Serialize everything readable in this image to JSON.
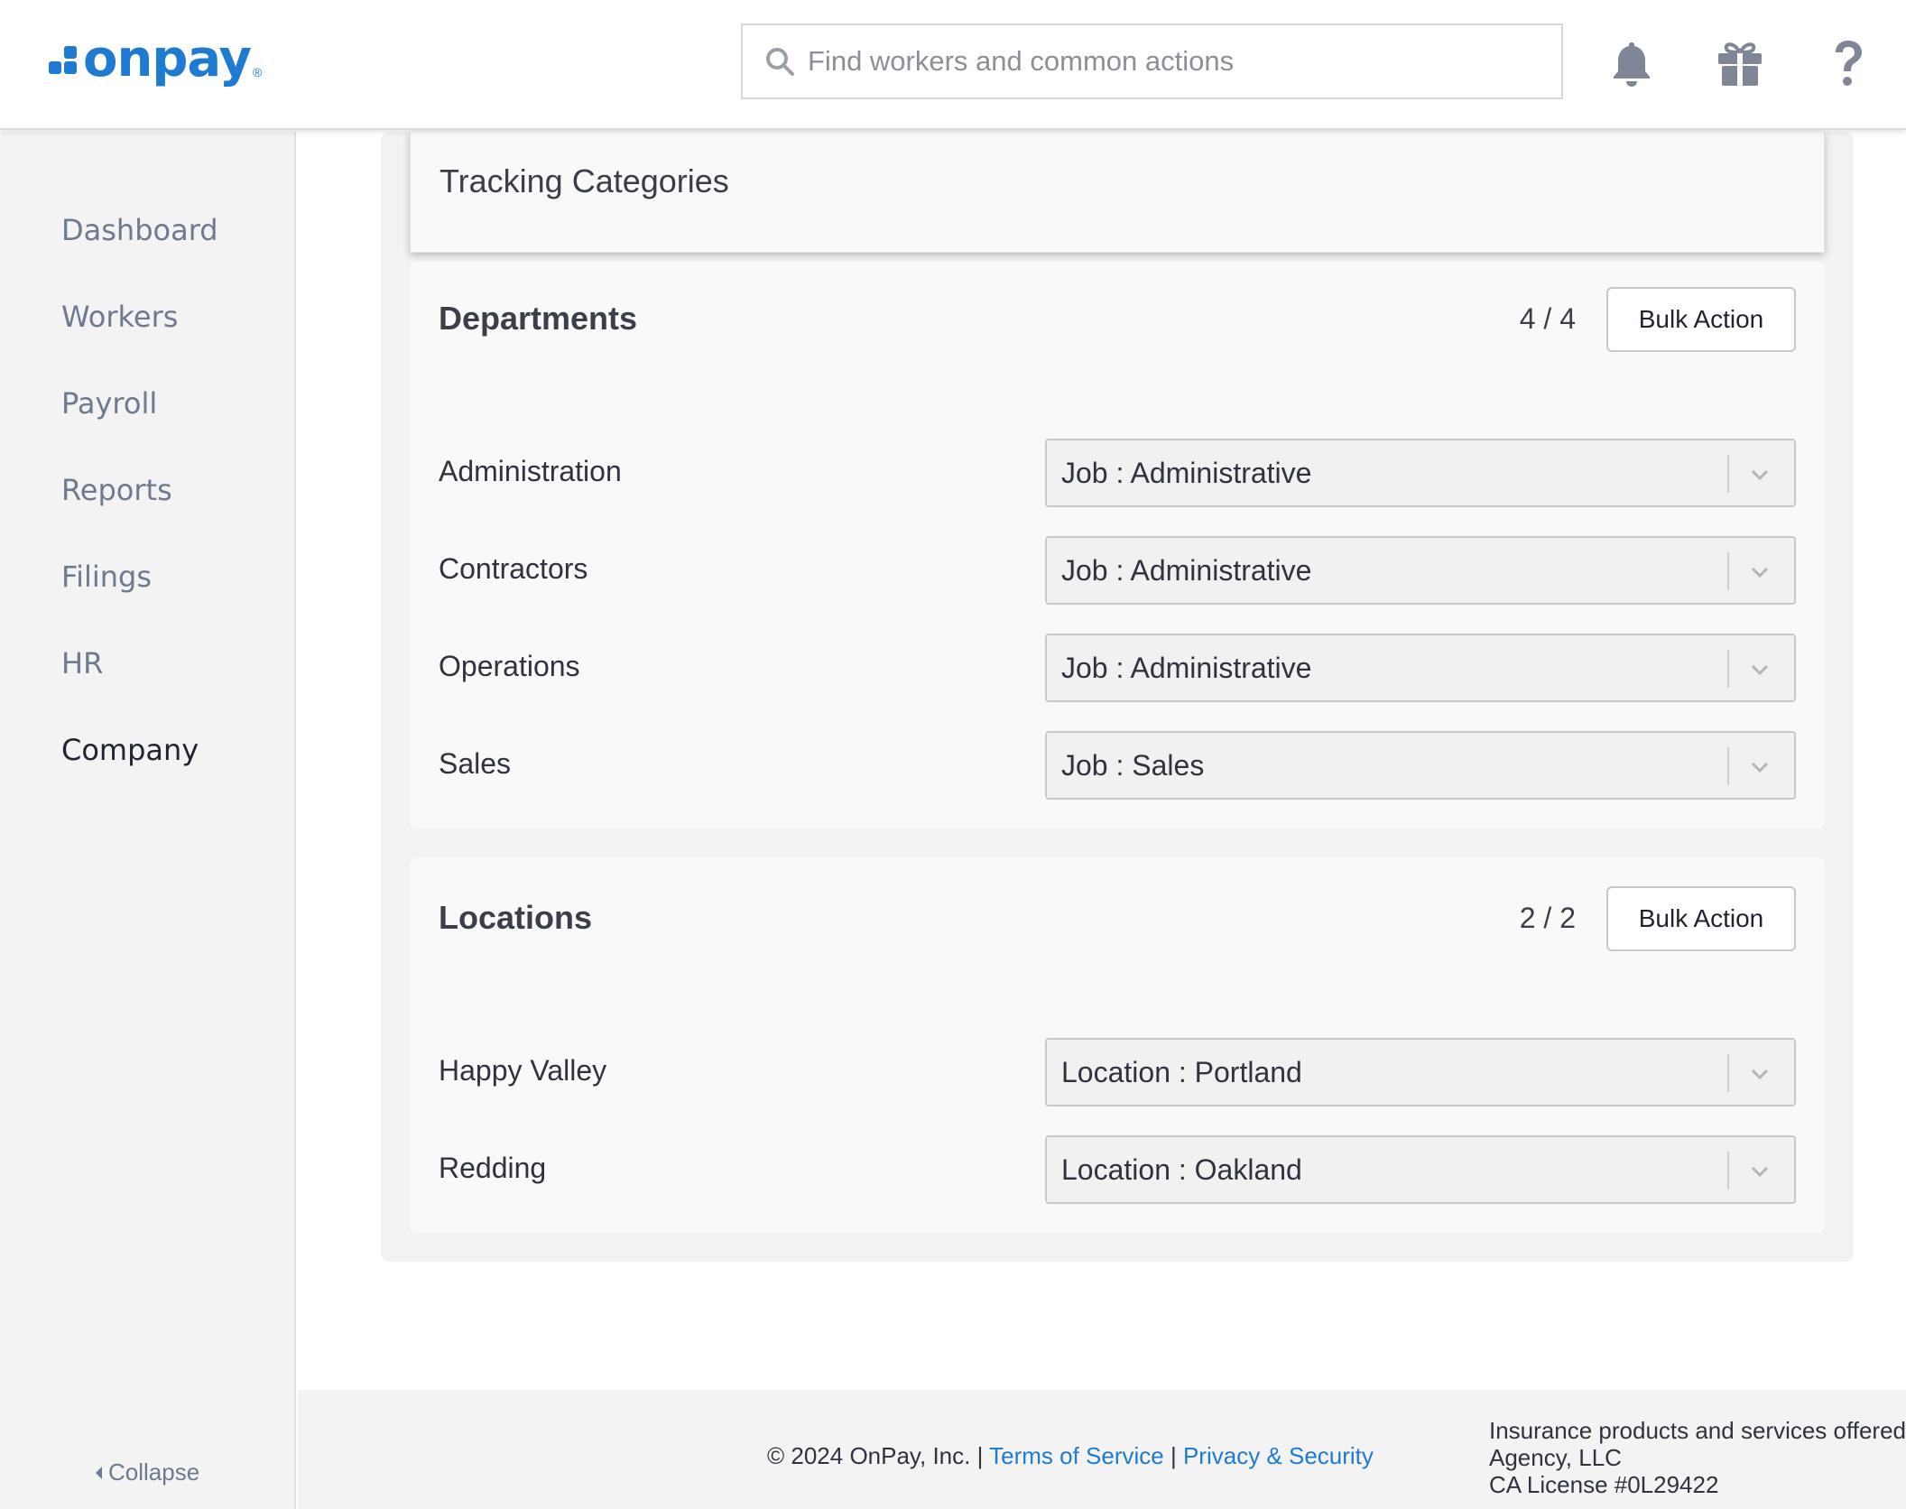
{
  "header": {
    "logo_text": "onpay",
    "logo_reg": "®",
    "search_placeholder": "Find workers and common actions",
    "icons": [
      "bell-icon",
      "gift-icon",
      "help-icon"
    ]
  },
  "sidebar": {
    "items": [
      {
        "label": "Dashboard",
        "active": false
      },
      {
        "label": "Workers",
        "active": false
      },
      {
        "label": "Payroll",
        "active": false
      },
      {
        "label": "Reports",
        "active": false
      },
      {
        "label": "Filings",
        "active": false
      },
      {
        "label": "HR",
        "active": false
      },
      {
        "label": "Company",
        "active": true
      }
    ],
    "collapse_label": "Collapse"
  },
  "main": {
    "title": "Tracking Categories",
    "departments": {
      "title": "Departments",
      "count": "4 / 4",
      "bulk_label": "Bulk Action",
      "rows": [
        {
          "label": "Administration",
          "value": "Job : Administrative"
        },
        {
          "label": "Contractors",
          "value": "Job : Administrative"
        },
        {
          "label": "Operations",
          "value": "Job : Administrative"
        },
        {
          "label": "Sales",
          "value": "Job : Sales"
        }
      ]
    },
    "locations": {
      "title": "Locations",
      "count": "2 / 2",
      "bulk_label": "Bulk Action",
      "rows": [
        {
          "label": "Happy Valley",
          "value": "Location : Portland"
        },
        {
          "label": "Redding",
          "value": "Location : Oakland"
        }
      ]
    }
  },
  "footer": {
    "copyright": "© 2024 OnPay, Inc. |",
    "terms": "Terms of Service",
    "divider": "|",
    "privacy": "Privacy & Security",
    "insurance_line1": "Insurance products and services offered",
    "insurance_line2": "Agency, LLC",
    "insurance_line3": "CA License #0L29422"
  },
  "colors": {
    "brand": "#1f7bd1",
    "nav_text": "#6e7a8f",
    "sidebar_bg": "#f3f3f3"
  }
}
